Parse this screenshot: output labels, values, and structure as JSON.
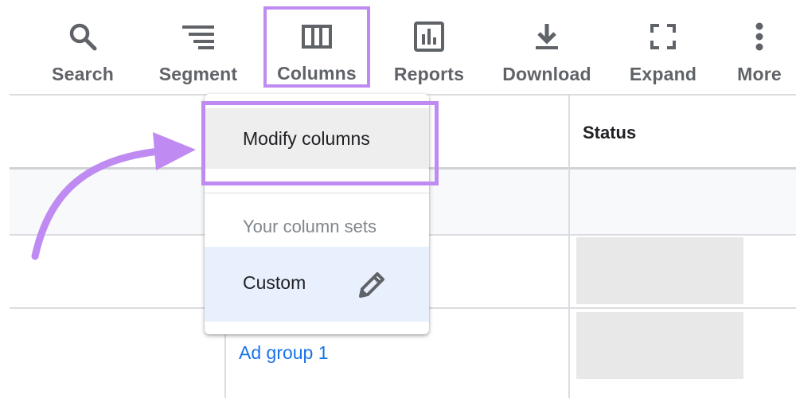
{
  "toolbar": {
    "items": [
      {
        "label": "Search",
        "icon": "search-icon"
      },
      {
        "label": "Segment",
        "icon": "segment-icon"
      },
      {
        "label": "Columns",
        "icon": "columns-icon"
      },
      {
        "label": "Reports",
        "icon": "reports-icon"
      },
      {
        "label": "Download",
        "icon": "download-icon"
      },
      {
        "label": "Expand",
        "icon": "expand-icon"
      },
      {
        "label": "More",
        "icon": "more-vertical-icon"
      }
    ]
  },
  "table": {
    "status_header": "Status",
    "row_link": "Ad group 1"
  },
  "menu": {
    "modify_columns": "Modify columns",
    "section_title": "Your column sets",
    "custom": "Custom",
    "custom_icon": "pencil-icon"
  },
  "colors": {
    "highlight": "#bf8af2",
    "icon_gray": "#5f6368",
    "link_blue": "#1a73e8",
    "selected_bg": "#e8f0fe"
  }
}
